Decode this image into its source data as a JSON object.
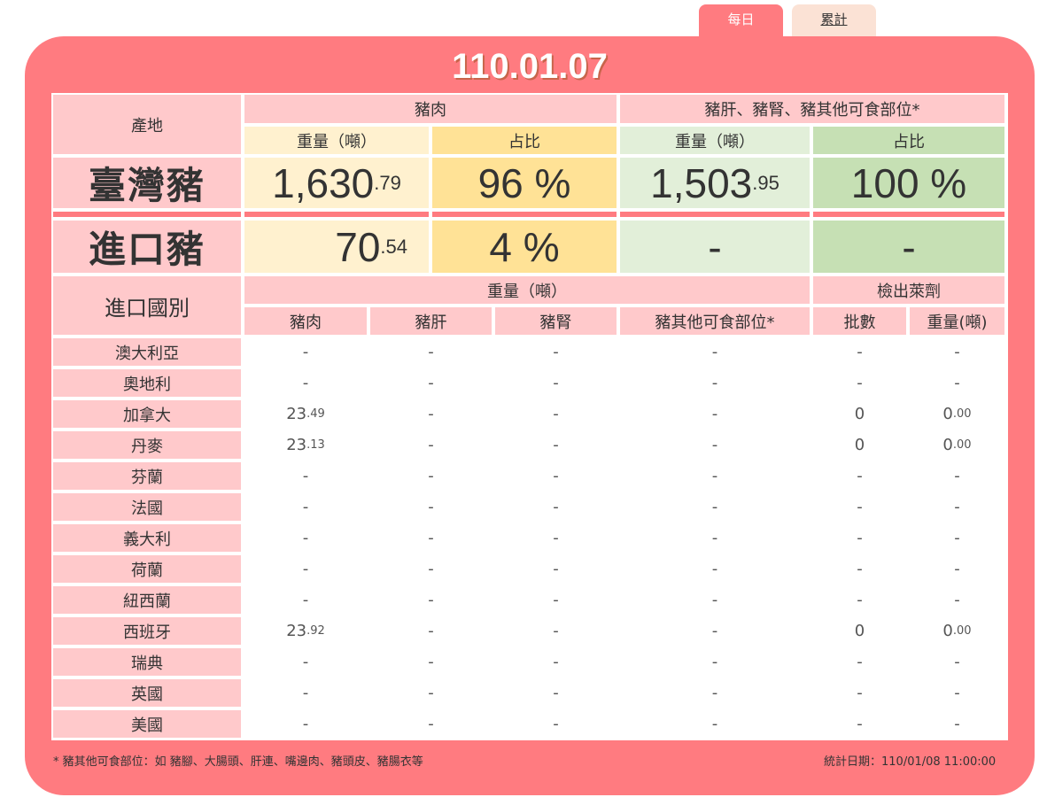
{
  "tabs": {
    "daily": "每日",
    "cumulative": "累計"
  },
  "date": "110.01.07",
  "header": {
    "origin": "產地",
    "pork": "豬肉",
    "offal": "豬肝、豬腎、豬其他可食部位*",
    "weight": "重量（噸）",
    "ratio": "占比"
  },
  "domestic": {
    "label": "臺灣豬",
    "pork_weight_int": "1,630",
    "pork_weight_dec": ".79",
    "pork_ratio": "96 %",
    "offal_weight_int": "1,503",
    "offal_weight_dec": ".95",
    "offal_ratio": "100 %"
  },
  "imported": {
    "label": "進口豬",
    "pork_weight_int": "70",
    "pork_weight_dec": ".54",
    "pork_ratio": "4 %",
    "offal_weight": "-",
    "offal_ratio": "-"
  },
  "country_table": {
    "title": "進口國別",
    "weight_header": "重量（噸）",
    "ractopamine_header": "檢出萊劑",
    "columns": [
      "豬肉",
      "豬肝",
      "豬腎",
      "豬其他可食部位*",
      "批數",
      "重量(噸)"
    ],
    "rows": [
      {
        "country": "澳大利亞",
        "pork_int": "-",
        "pork_dec": "",
        "liver": "-",
        "kidney": "-",
        "other": "-",
        "batches": "-",
        "det_int": "-",
        "det_dec": ""
      },
      {
        "country": "奧地利",
        "pork_int": "-",
        "pork_dec": "",
        "liver": "-",
        "kidney": "-",
        "other": "-",
        "batches": "-",
        "det_int": "-",
        "det_dec": ""
      },
      {
        "country": "加拿大",
        "pork_int": "23",
        "pork_dec": ".49",
        "liver": "-",
        "kidney": "-",
        "other": "-",
        "batches": "0",
        "det_int": "0",
        "det_dec": ".00"
      },
      {
        "country": "丹麥",
        "pork_int": "23",
        "pork_dec": ".13",
        "liver": "-",
        "kidney": "-",
        "other": "-",
        "batches": "0",
        "det_int": "0",
        "det_dec": ".00"
      },
      {
        "country": "芬蘭",
        "pork_int": "-",
        "pork_dec": "",
        "liver": "-",
        "kidney": "-",
        "other": "-",
        "batches": "-",
        "det_int": "-",
        "det_dec": ""
      },
      {
        "country": "法國",
        "pork_int": "-",
        "pork_dec": "",
        "liver": "-",
        "kidney": "-",
        "other": "-",
        "batches": "-",
        "det_int": "-",
        "det_dec": ""
      },
      {
        "country": "義大利",
        "pork_int": "-",
        "pork_dec": "",
        "liver": "-",
        "kidney": "-",
        "other": "-",
        "batches": "-",
        "det_int": "-",
        "det_dec": ""
      },
      {
        "country": "荷蘭",
        "pork_int": "-",
        "pork_dec": "",
        "liver": "-",
        "kidney": "-",
        "other": "-",
        "batches": "-",
        "det_int": "-",
        "det_dec": ""
      },
      {
        "country": "紐西蘭",
        "pork_int": "-",
        "pork_dec": "",
        "liver": "-",
        "kidney": "-",
        "other": "-",
        "batches": "-",
        "det_int": "-",
        "det_dec": ""
      },
      {
        "country": "西班牙",
        "pork_int": "23",
        "pork_dec": ".92",
        "liver": "-",
        "kidney": "-",
        "other": "-",
        "batches": "0",
        "det_int": "0",
        "det_dec": ".00"
      },
      {
        "country": "瑞典",
        "pork_int": "-",
        "pork_dec": "",
        "liver": "-",
        "kidney": "-",
        "other": "-",
        "batches": "-",
        "det_int": "-",
        "det_dec": ""
      },
      {
        "country": "英國",
        "pork_int": "-",
        "pork_dec": "",
        "liver": "-",
        "kidney": "-",
        "other": "-",
        "batches": "-",
        "det_int": "-",
        "det_dec": ""
      },
      {
        "country": "美國",
        "pork_int": "-",
        "pork_dec": "",
        "liver": "-",
        "kidney": "-",
        "other": "-",
        "batches": "-",
        "det_int": "-",
        "det_dec": ""
      }
    ]
  },
  "footnote": "* 豬其他可食部位：如 豬腳、大腸頭、肝連、嘴邊肉、豬頭皮、豬腸衣等",
  "stat_date": "統計日期：110/01/08 11:00:00",
  "colors": {
    "accent": "#ff7b80",
    "pink": "#ffc9cb",
    "cream": "#fff1cf",
    "yellow": "#ffe296",
    "light_green": "#e2efd9",
    "green": "#c6e0b4"
  }
}
